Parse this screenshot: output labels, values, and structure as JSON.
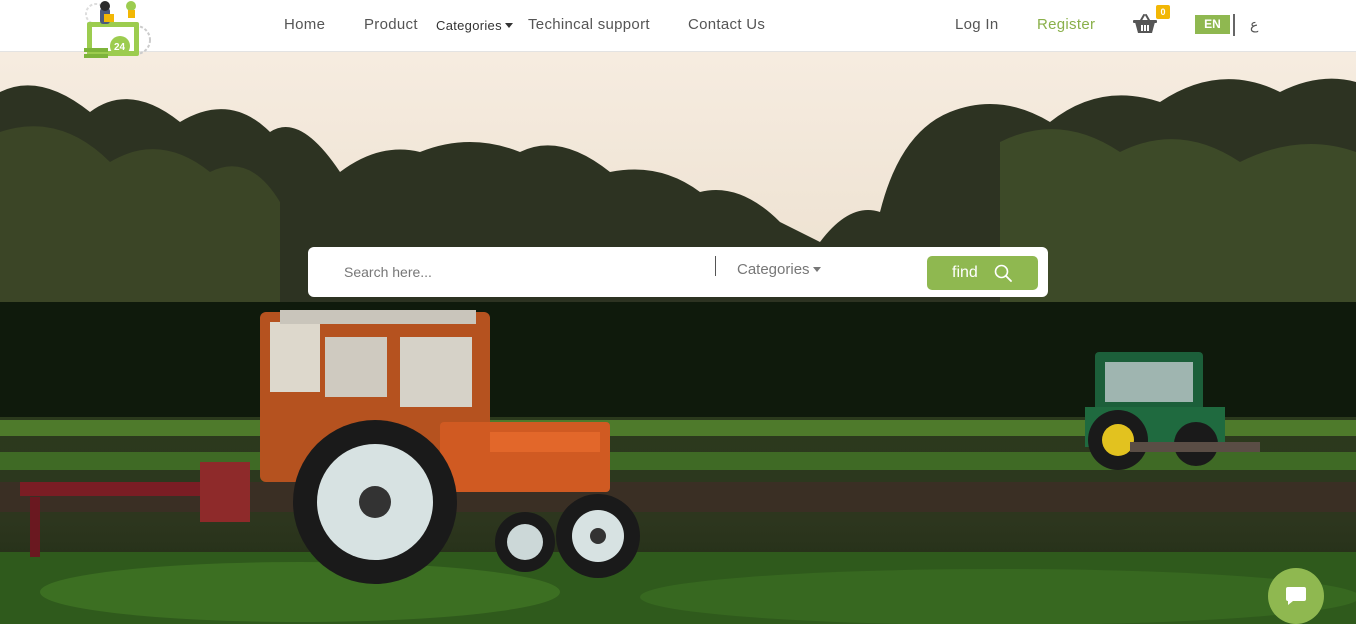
{
  "header": {
    "nav": {
      "home": "Home",
      "product": "Product",
      "categories": "Categories",
      "support": "Techincal support",
      "contact": "Contact Us"
    },
    "auth": {
      "login": "Log In",
      "register": "Register"
    },
    "cart": {
      "count": "0"
    },
    "language": {
      "current": "EN",
      "alternate": "ع"
    }
  },
  "search": {
    "placeholder": "Search here...",
    "category_label": "Categories",
    "find_label": "find"
  },
  "colors": {
    "accent": "#8fb850",
    "badge": "#f2b705",
    "nav_text": "#555555"
  },
  "icons": {
    "cart": "basket-icon",
    "search": "magnifier-icon",
    "chat": "chat-bubble-icon",
    "dropdown": "caret-down-icon"
  }
}
